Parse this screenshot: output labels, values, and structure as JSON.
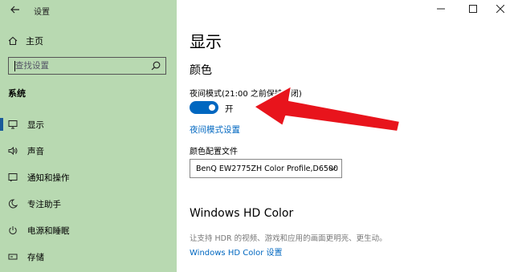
{
  "window": {
    "title": "设置",
    "controls": [
      "minimize",
      "maximize",
      "close"
    ]
  },
  "sidebar": {
    "home_label": "主页",
    "search_placeholder": "查找设置",
    "section_label": "系统",
    "items": [
      {
        "label": "显示",
        "icon": "monitor-icon",
        "active": true
      },
      {
        "label": "声音",
        "icon": "speaker-icon",
        "active": false
      },
      {
        "label": "通知和操作",
        "icon": "notification-icon",
        "active": false
      },
      {
        "label": "专注助手",
        "icon": "moon-icon",
        "active": false
      },
      {
        "label": "电源和睡眠",
        "icon": "power-icon",
        "active": false
      },
      {
        "label": "存储",
        "icon": "storage-icon",
        "active": false
      }
    ]
  },
  "main": {
    "page_title": "显示",
    "color_heading": "颜色",
    "night_light_label": "夜间模式(21:00 之前保持关闭)",
    "night_light_toggle_state": "开",
    "night_light_settings_link": "夜间模式设置",
    "color_profile_label": "颜色配置文件",
    "color_profile_value": "BenQ EW2775ZH Color Profile,D6500",
    "hd_color_heading": "Windows HD Color",
    "hd_color_description": "让支持 HDR 的视频、游戏和应用的画面更明亮、更生动。",
    "hd_color_link": "Windows HD Color 设置"
  },
  "colors": {
    "sidebar_bg": "#b8d9b1",
    "accent": "#0067c0",
    "annotation_arrow": "#e8141c"
  }
}
